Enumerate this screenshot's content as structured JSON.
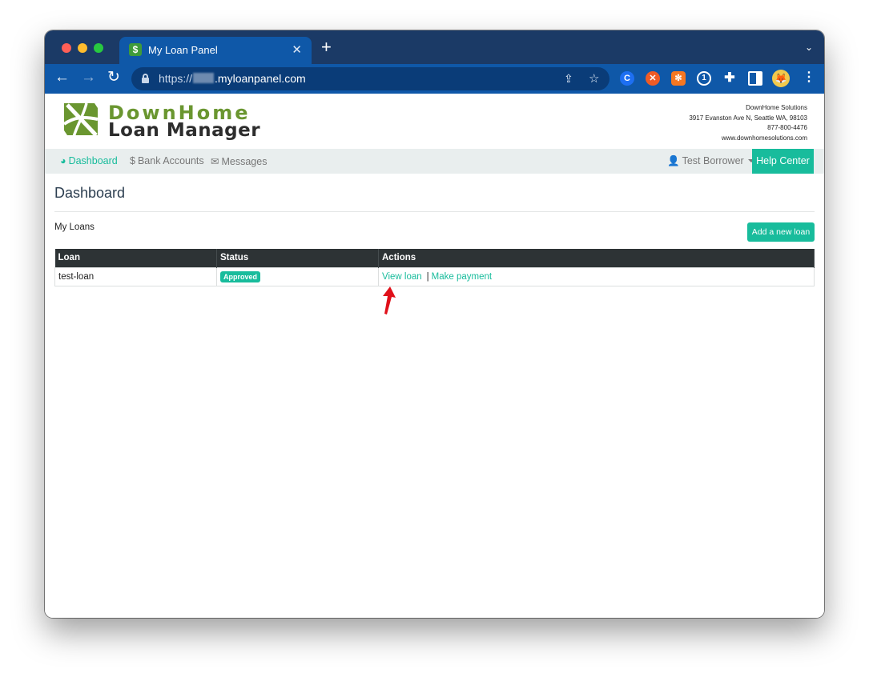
{
  "browser": {
    "tab_title": "My Loan Panel",
    "tab_favicon_glyph": "$",
    "url_scheme": "https://",
    "url_host": ".myloanpanel.com",
    "profile_initial": "🦊"
  },
  "logo": {
    "line1": "DownHome",
    "line2": "Loan Manager"
  },
  "company": {
    "name": "DownHome Solutions",
    "address": "3917 Evanston Ave N, Seattle WA, 98103",
    "phone": "877-800-4476",
    "website": "www.downhomesolutions.com"
  },
  "nav": {
    "dashboard": "Dashboard",
    "bank_accounts": "Bank Accounts",
    "messages": "Messages",
    "user": "Test Borrower",
    "help": "Help Center"
  },
  "main": {
    "title": "Dashboard",
    "section": "My Loans",
    "add_button": "Add a new loan",
    "table": {
      "headers": [
        "Loan",
        "Status",
        "Actions"
      ],
      "rows": [
        {
          "loan": "test-loan",
          "status": "Approved",
          "view_link": "View loan",
          "separator": "|",
          "pay_link": "Make payment"
        }
      ]
    }
  },
  "colors": {
    "accent": "#18bc9c",
    "browser_frame": "#0f58a8",
    "table_header": "#2d3335",
    "annotation_arrow": "#e0101a"
  }
}
